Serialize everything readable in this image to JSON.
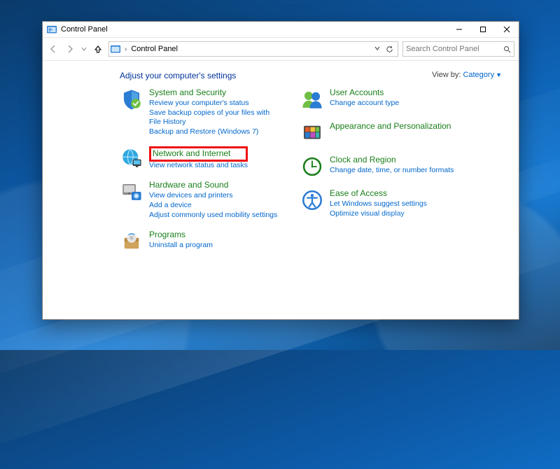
{
  "window": {
    "title": "Control Panel"
  },
  "address": {
    "path": "Control Panel"
  },
  "search": {
    "placeholder": "Search Control Panel"
  },
  "heading": "Adjust your computer's settings",
  "viewby": {
    "label": "View by:",
    "value": "Category"
  },
  "left": [
    {
      "title": "System and Security",
      "links": [
        "Review your computer's status",
        "Save backup copies of your files with File History",
        "Backup and Restore (Windows 7)"
      ]
    },
    {
      "title": "Network and Internet",
      "highlighted": true,
      "links": [
        "View network status and tasks"
      ]
    },
    {
      "title": "Hardware and Sound",
      "links": [
        "View devices and printers",
        "Add a device",
        "Adjust commonly used mobility settings"
      ]
    },
    {
      "title": "Programs",
      "links": [
        "Uninstall a program"
      ]
    }
  ],
  "right": [
    {
      "title": "User Accounts",
      "links": [
        "Change account type"
      ]
    },
    {
      "title": "Appearance and Personalization",
      "links": []
    },
    {
      "title": "Clock and Region",
      "links": [
        "Change date, time, or number formats"
      ]
    },
    {
      "title": "Ease of Access",
      "links": [
        "Let Windows suggest settings",
        "Optimize visual display"
      ]
    }
  ]
}
